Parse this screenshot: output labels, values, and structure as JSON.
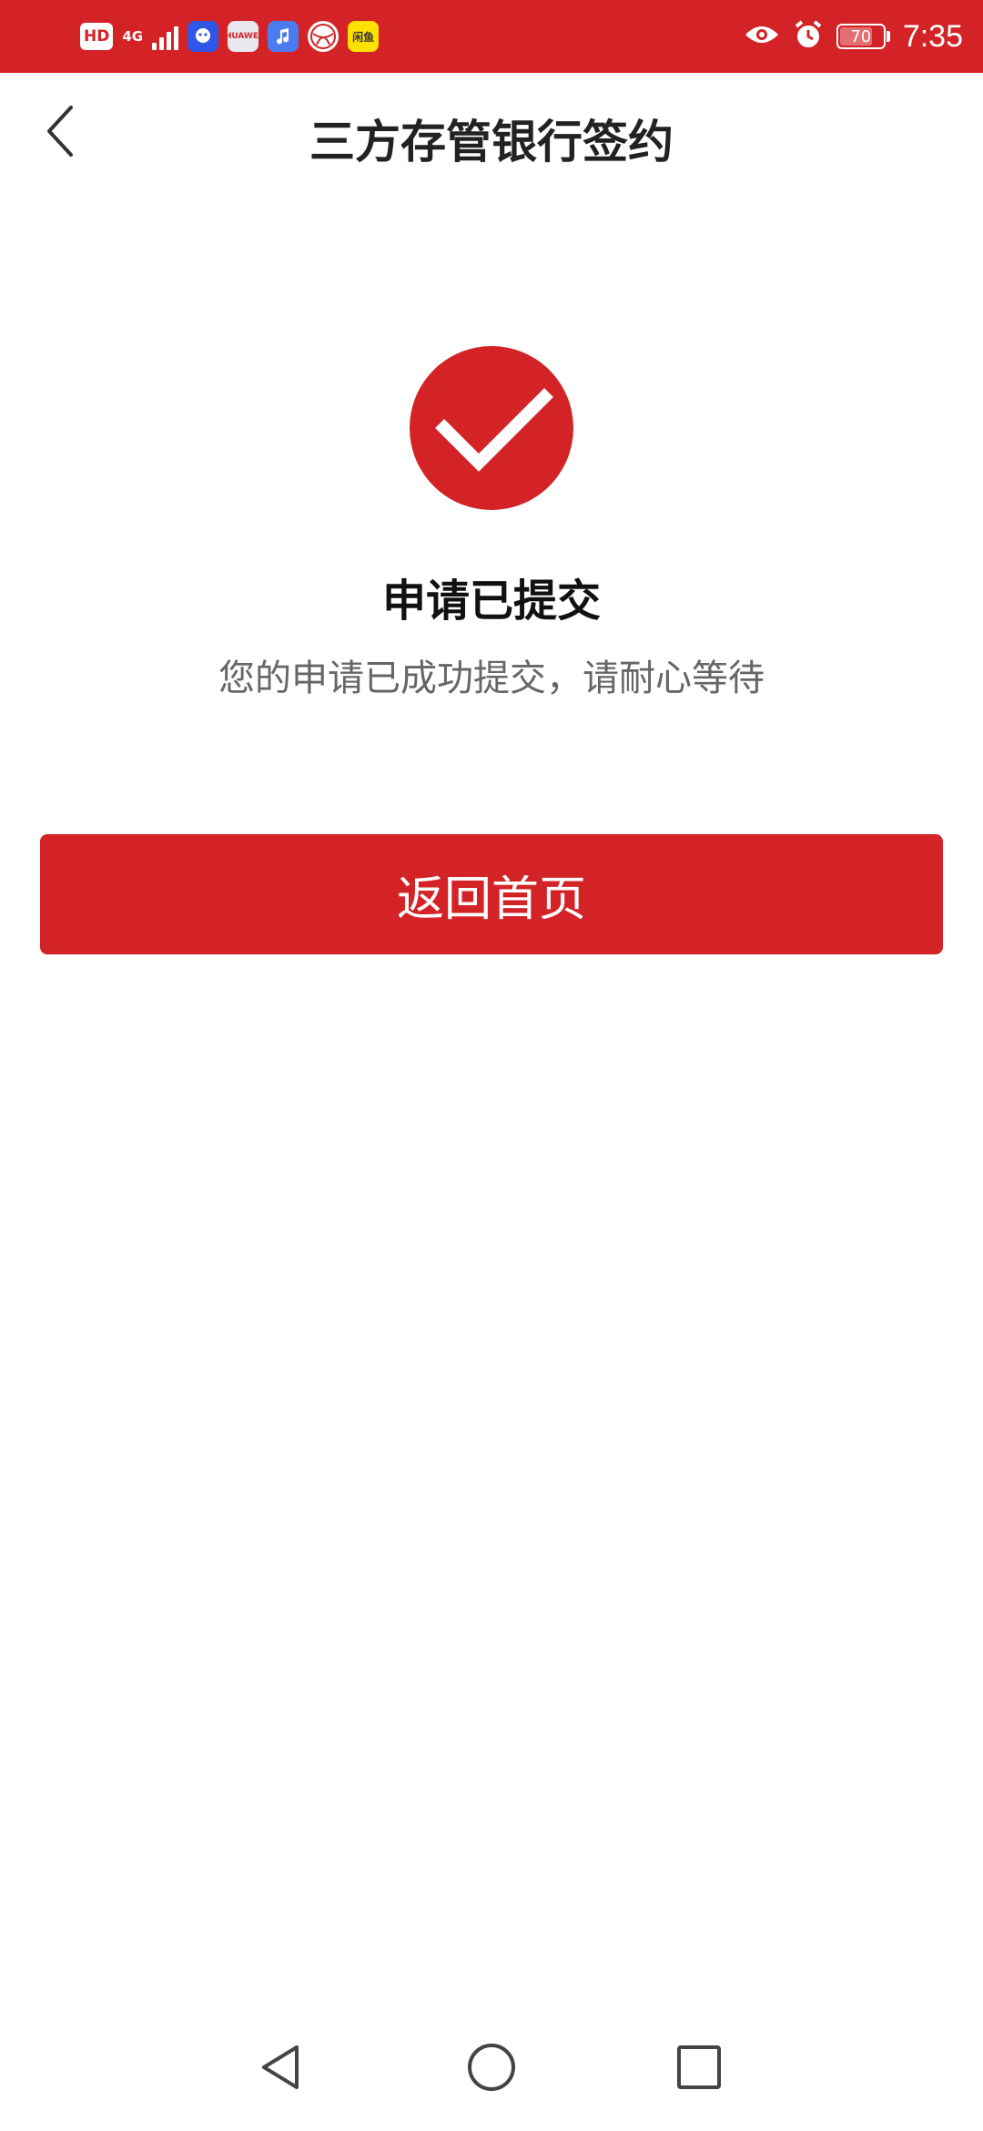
{
  "status_bar": {
    "hd_label": "HD",
    "network_label": "4G",
    "app_icons": [
      "qq-icon",
      "huawei-store-icon",
      "music-icon",
      "browser-icon",
      "xianyu-icon"
    ],
    "app_icon_texts": {
      "huawei": "HUAWEI",
      "xianyu": "闲鱼"
    },
    "battery": "70",
    "time": "7:35",
    "color": "#d42327"
  },
  "header": {
    "title": "三方存管银行签约"
  },
  "result": {
    "title": "申请已提交",
    "description": "您的申请已成功提交，请耐心等待"
  },
  "actions": {
    "home_button_label": "返回首页"
  },
  "colors": {
    "accent": "#d42327",
    "title_text": "#222222",
    "desc_text": "#666666"
  }
}
